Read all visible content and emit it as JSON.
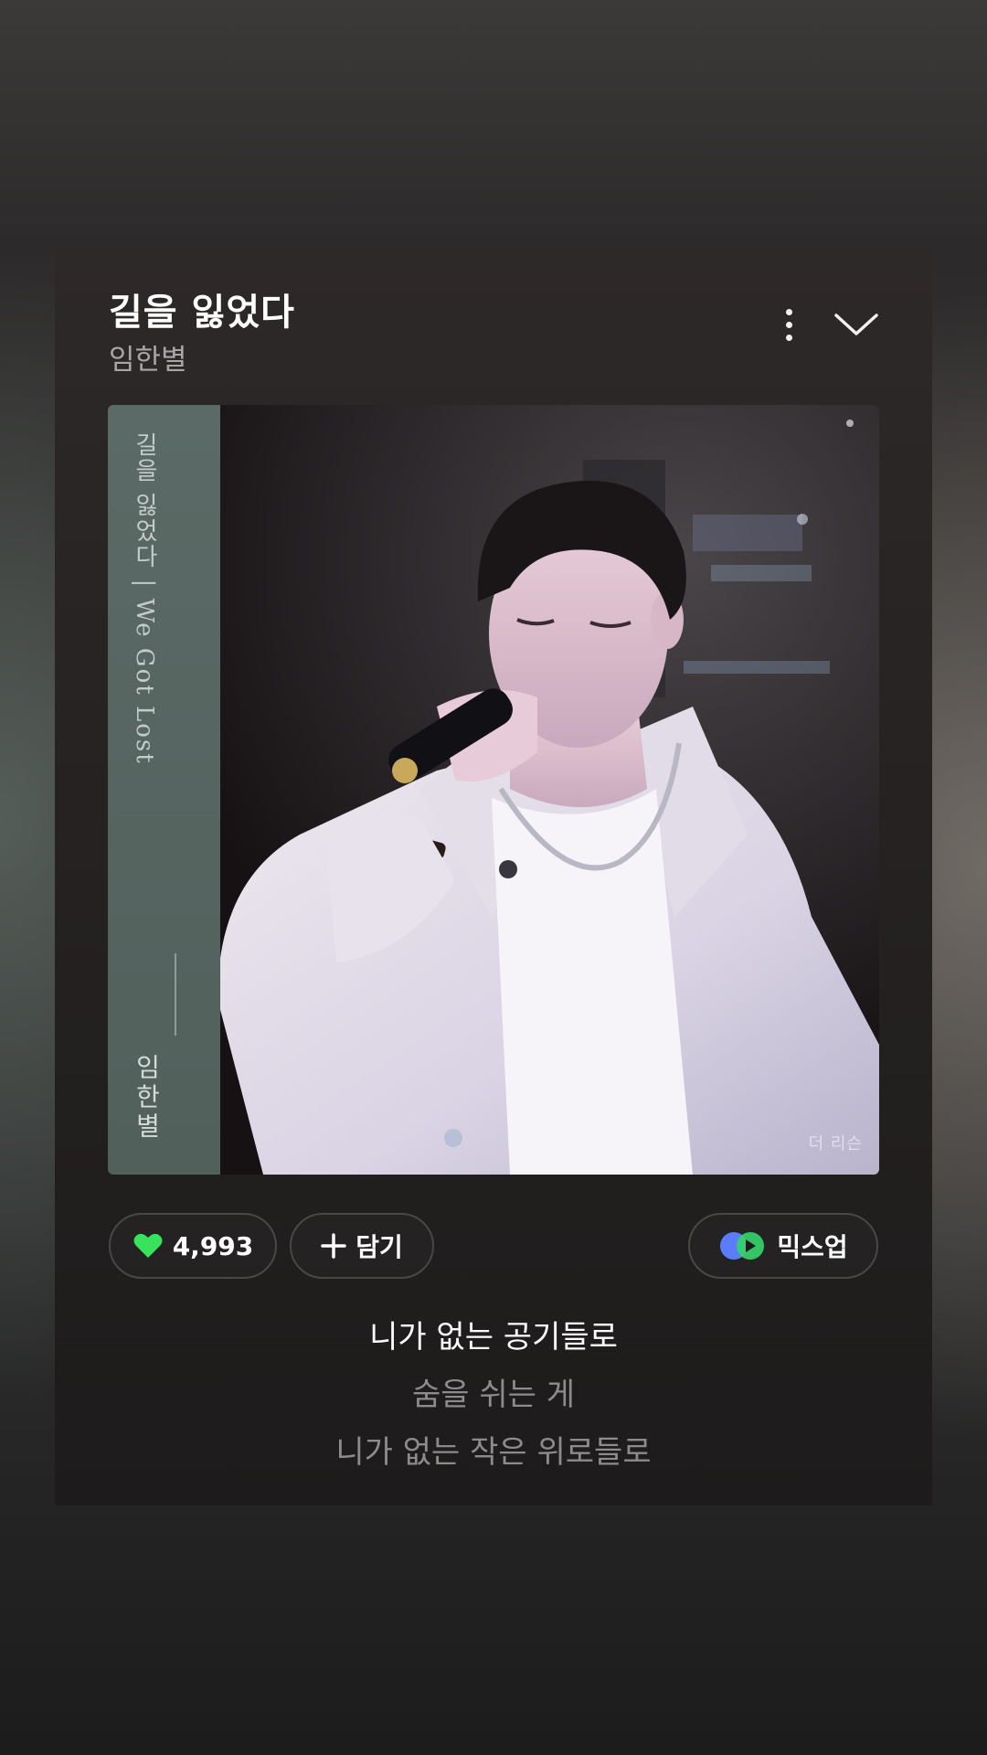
{
  "player": {
    "song_title": "길을 잃었다",
    "artist": "임한별",
    "cover": {
      "spine_title": "길을 잃었다 | We Got Lost",
      "spine_artist": "임한별",
      "watermark": "더 리슨"
    },
    "actions": {
      "like_count": "4,993",
      "add_label": "담기",
      "mixup_label": "믹스업"
    },
    "lyrics": [
      "니가 없는 공기들로",
      "숨을 쉬는 게",
      "니가 없는 작은 위로들로"
    ],
    "icons": {
      "more": "more-vertical-icon",
      "collapse": "chevron-down-icon",
      "like": "heart-icon",
      "add": "plus-icon",
      "mixup": "mixup-icon"
    },
    "colors": {
      "heart": "#39e25b",
      "mixup_green": "#35d36a",
      "mixup_blue": "#5b7cff"
    }
  }
}
